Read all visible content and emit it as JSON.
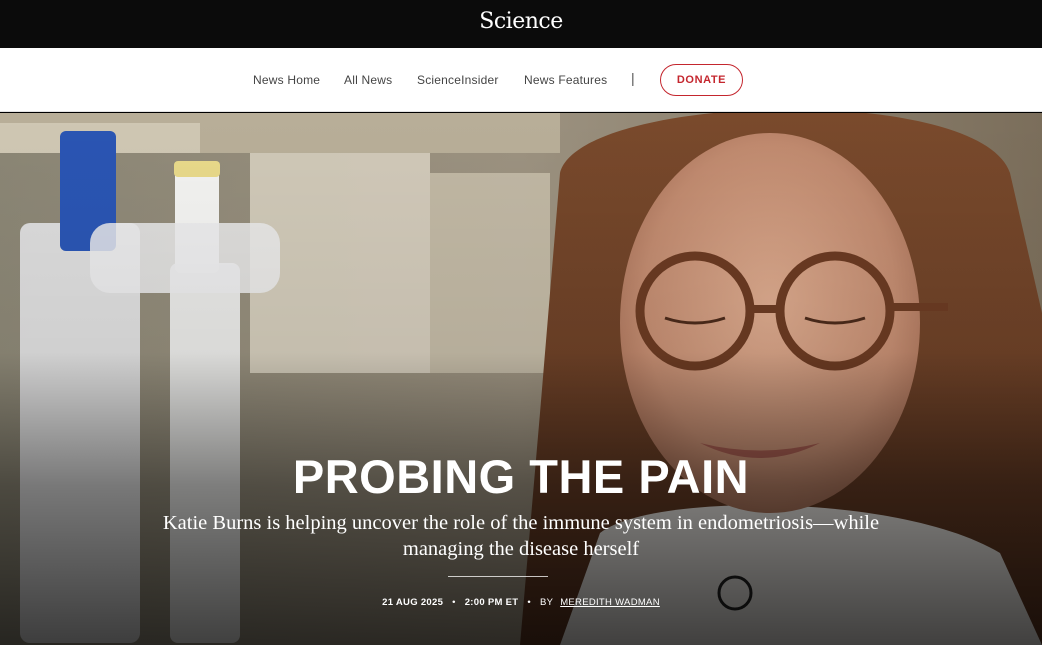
{
  "header": {
    "logo": "Science"
  },
  "nav": {
    "items": [
      {
        "label": "News Home"
      },
      {
        "label": "All News"
      },
      {
        "label": "ScienceInsider"
      },
      {
        "label": "News Features"
      }
    ],
    "separator": "|",
    "donate_label": "DONATE"
  },
  "article": {
    "headline": "PROBING THE PAIN",
    "dek": "Katie Burns is helping uncover the role of the immune system in endometriosis—while managing the disease herself",
    "date": "21 AUG 2025",
    "time": "2:00 PM ET",
    "by": "BY",
    "author": "MEREDITH WADMAN",
    "dot": "•"
  },
  "colors": {
    "brand_red": "#c4262e",
    "topbar": "#0b0b0b"
  }
}
